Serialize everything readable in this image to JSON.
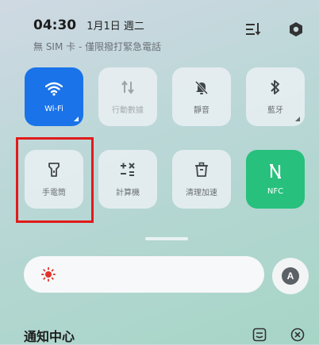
{
  "status_bar": {
    "time": "04:30",
    "date": "1月1日 週二",
    "sim_status": "無 SIM 卡 - 僅限撥打緊急電話"
  },
  "top_icons": [
    "sort-icon",
    "settings-icon"
  ],
  "tiles": [
    {
      "label": "Wi-Fi",
      "icon": "wifi-icon",
      "state": "on"
    },
    {
      "label": "行動數據",
      "icon": "mobile-data-icon",
      "state": "disabled"
    },
    {
      "label": "靜音",
      "icon": "bell-off-icon",
      "state": "off"
    },
    {
      "label": "藍牙",
      "icon": "bluetooth-icon",
      "state": "off"
    },
    {
      "label": "手電筒",
      "icon": "flashlight-icon",
      "state": "off"
    },
    {
      "label": "計算機",
      "icon": "calculator-icon",
      "state": "off"
    },
    {
      "label": "清理加速",
      "icon": "trash-icon",
      "state": "off"
    },
    {
      "label": "NFC",
      "icon": "nfc-icon",
      "state": "on"
    }
  ],
  "brightness": {
    "icon": "sun-icon",
    "auto_label": "A"
  },
  "notification": {
    "title": "通知中心"
  },
  "colors": {
    "wifi_active": "#1a73e8",
    "nfc_active": "#27c07d",
    "highlight": "#e01a1a"
  }
}
